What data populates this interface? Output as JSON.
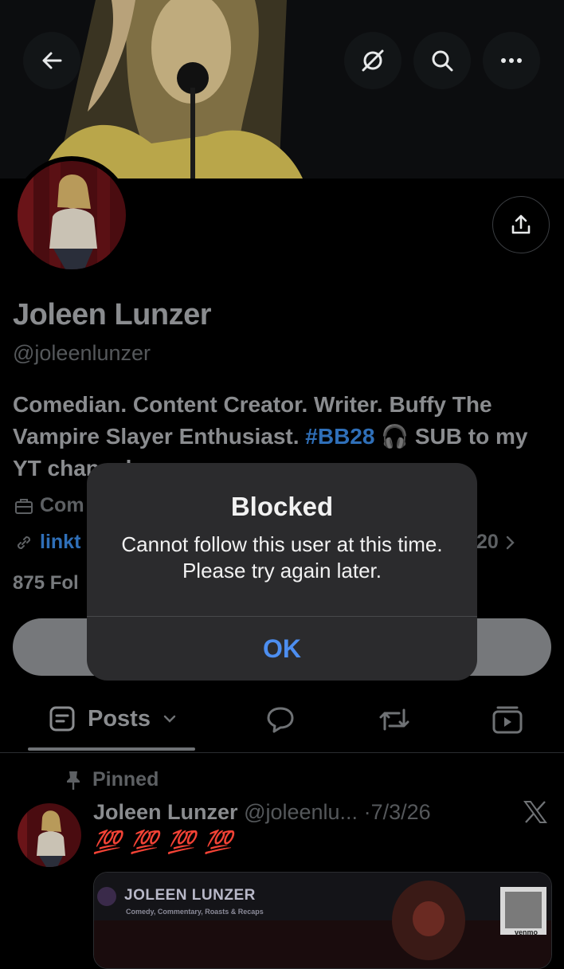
{
  "header": {
    "back_icon": "arrow-left-icon",
    "grok_icon": "slashed-circle-icon",
    "search_icon": "search-icon",
    "more_icon": "ellipsis-icon"
  },
  "profile": {
    "name": "Joleen Lunzer",
    "handle": "@joleenlunzer",
    "bio_part1": "Comedian. Content Creator. Writer. Buffy The Vampire Slayer Enthusiast. ",
    "bio_hashtag": "#BB28",
    "bio_part2": " 🎧 SUB to my YT channel",
    "category_prefix": "Com",
    "link_prefix": "linkt",
    "joined_suffix": "20",
    "followers_prefix": "875 Fol",
    "share_icon": "share-icon"
  },
  "tabs": {
    "posts_label": "Posts",
    "posts_icon": "posts-icon",
    "replies_icon": "speech-bubble-icon",
    "reposts_icon": "repost-icon",
    "media_icon": "video-icon"
  },
  "pinned_post": {
    "pinned_label": "Pinned",
    "author": "Joleen Lunzer",
    "handle": "@joleenlu...",
    "date": "·7/3/26",
    "emojis": "💯 💯 💯 💯",
    "media_title": "JOLEEN LUNZER",
    "media_subtitle": "Comedy, Commentary, Roasts & Recaps",
    "media_qr_label": "venmo"
  },
  "alert": {
    "title": "Blocked",
    "message": "Cannot follow this user at this time. Please try again later.",
    "ok_label": "OK"
  },
  "colors": {
    "background": "#000000",
    "alert_bg": "#2b2b2d",
    "alert_button": "#4d8ef0",
    "link_blue": "#2f6fb8"
  }
}
